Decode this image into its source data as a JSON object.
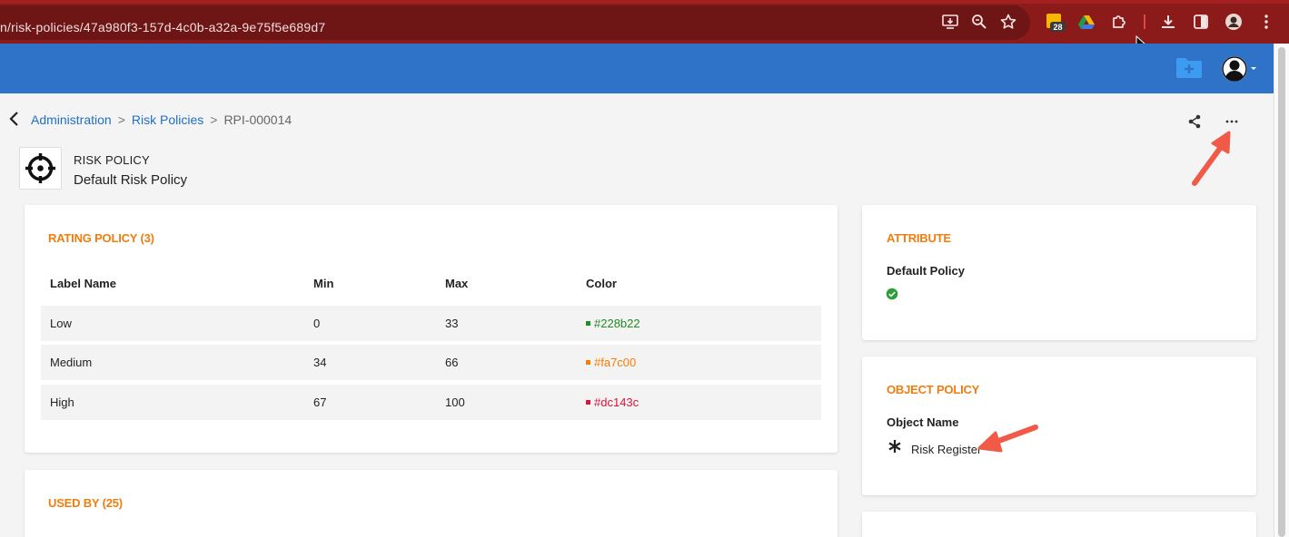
{
  "browser": {
    "url": "n/risk-policies/47a980f3-157d-4c0b-a32a-9e75f5e689d7",
    "extension_badge": "28",
    "icons": [
      "install-app-icon",
      "zoom-icon",
      "bookmark-star-icon",
      "calendar-extension-icon",
      "drive-extension-icon",
      "extensions-puzzle-icon",
      "download-icon",
      "sidepanel-icon",
      "profile-avatar-icon",
      "kebab-menu-icon"
    ]
  },
  "header": {
    "icons": [
      "add-folder-icon",
      "user-avatar-icon"
    ],
    "brand_color": "#2f73c9"
  },
  "breadcrumb": {
    "items": [
      "Administration",
      "Risk Policies",
      "RPI-000014"
    ],
    "separator": ">"
  },
  "entity": {
    "type_label": "RISK POLICY",
    "name": "Default Risk Policy",
    "icon": "crosshair-icon"
  },
  "rating_policy": {
    "title": "RATING POLICY (3)",
    "columns": [
      "Label Name",
      "Min",
      "Max",
      "Color"
    ],
    "rows": [
      {
        "label": "Low",
        "min": "0",
        "max": "33",
        "color": "#228b22"
      },
      {
        "label": "Medium",
        "min": "34",
        "max": "66",
        "color": "#fa7c00"
      },
      {
        "label": "High",
        "min": "67",
        "max": "100",
        "color": "#dc143c"
      }
    ]
  },
  "used_by": {
    "title": "USED BY (25)"
  },
  "attribute": {
    "title": "ATTRIBUTE",
    "label": "Default Policy",
    "value_icon": "check-circle-icon",
    "value_color": "#2e9e3a"
  },
  "object_policy": {
    "title": "OBJECT POLICY",
    "label": "Object Name",
    "value": "Risk Register",
    "value_icon": "asterisk-icon"
  },
  "colors": {
    "accent": "#f07d0e",
    "link": "#1f6fc4",
    "annotation": "#f05a47"
  }
}
